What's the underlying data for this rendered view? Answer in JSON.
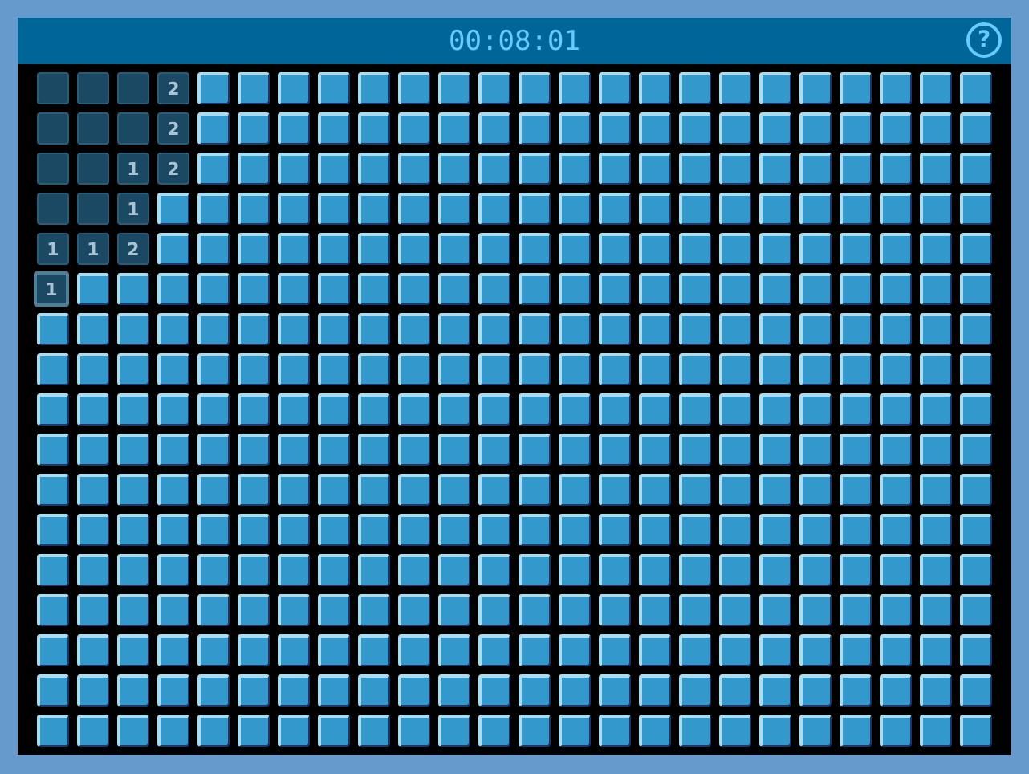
{
  "header": {
    "timer": "00:08:01",
    "help_button": "?"
  },
  "board": {
    "rows": [
      [
        {
          "revealed": true,
          "selected": false
        },
        {
          "revealed": true,
          "selected": false
        },
        {
          "revealed": true,
          "selected": false
        },
        {
          "revealed": true,
          "selected": false,
          "number": "2"
        },
        {
          "revealed": false,
          "selected": false
        },
        {
          "revealed": false,
          "selected": false
        },
        {
          "revealed": false,
          "selected": false
        },
        {
          "revealed": false,
          "selected": false
        },
        {
          "revealed": false,
          "selected": false
        },
        {
          "revealed": false,
          "selected": false
        },
        {
          "revealed": false,
          "selected": false
        },
        {
          "revealed": false,
          "selected": false
        },
        {
          "revealed": false,
          "selected": false
        },
        {
          "revealed": false,
          "selected": false
        },
        {
          "revealed": false,
          "selected": false
        },
        {
          "revealed": false,
          "selected": false
        },
        {
          "revealed": false,
          "selected": false
        },
        {
          "revealed": false,
          "selected": false
        },
        {
          "revealed": false,
          "selected": false
        },
        {
          "revealed": false,
          "selected": false
        },
        {
          "revealed": false,
          "selected": false
        },
        {
          "revealed": false,
          "selected": false
        },
        {
          "revealed": false,
          "selected": false
        },
        {
          "revealed": false,
          "selected": false
        }
      ],
      [
        {
          "revealed": true,
          "selected": false
        },
        {
          "revealed": true,
          "selected": false
        },
        {
          "revealed": true,
          "selected": false
        },
        {
          "revealed": true,
          "selected": false,
          "number": "2"
        },
        {
          "revealed": false,
          "selected": false
        },
        {
          "revealed": false,
          "selected": false
        },
        {
          "revealed": false,
          "selected": false
        },
        {
          "revealed": false,
          "selected": false
        },
        {
          "revealed": false,
          "selected": false
        },
        {
          "revealed": false,
          "selected": false
        },
        {
          "revealed": false,
          "selected": false
        },
        {
          "revealed": false,
          "selected": false
        },
        {
          "revealed": false,
          "selected": false
        },
        {
          "revealed": false,
          "selected": false
        },
        {
          "revealed": false,
          "selected": false
        },
        {
          "revealed": false,
          "selected": false
        },
        {
          "revealed": false,
          "selected": false
        },
        {
          "revealed": false,
          "selected": false
        },
        {
          "revealed": false,
          "selected": false
        },
        {
          "revealed": false,
          "selected": false
        },
        {
          "revealed": false,
          "selected": false
        },
        {
          "revealed": false,
          "selected": false
        },
        {
          "revealed": false,
          "selected": false
        },
        {
          "revealed": false,
          "selected": false
        }
      ],
      [
        {
          "revealed": true,
          "selected": false
        },
        {
          "revealed": true,
          "selected": false
        },
        {
          "revealed": true,
          "selected": false,
          "number": "1"
        },
        {
          "revealed": true,
          "selected": false,
          "number": "2"
        },
        {
          "revealed": false,
          "selected": false
        },
        {
          "revealed": false,
          "selected": false
        },
        {
          "revealed": false,
          "selected": false
        },
        {
          "revealed": false,
          "selected": false
        },
        {
          "revealed": false,
          "selected": false
        },
        {
          "revealed": false,
          "selected": false
        },
        {
          "revealed": false,
          "selected": false
        },
        {
          "revealed": false,
          "selected": false
        },
        {
          "revealed": false,
          "selected": false
        },
        {
          "revealed": false,
          "selected": false
        },
        {
          "revealed": false,
          "selected": false
        },
        {
          "revealed": false,
          "selected": false
        },
        {
          "revealed": false,
          "selected": false
        },
        {
          "revealed": false,
          "selected": false
        },
        {
          "revealed": false,
          "selected": false
        },
        {
          "revealed": false,
          "selected": false
        },
        {
          "revealed": false,
          "selected": false
        },
        {
          "revealed": false,
          "selected": false
        },
        {
          "revealed": false,
          "selected": false
        },
        {
          "revealed": false,
          "selected": false
        }
      ],
      [
        {
          "revealed": true,
          "selected": false
        },
        {
          "revealed": true,
          "selected": false
        },
        {
          "revealed": true,
          "selected": false,
          "number": "1"
        },
        {
          "revealed": false,
          "selected": false
        },
        {
          "revealed": false,
          "selected": false
        },
        {
          "revealed": false,
          "selected": false
        },
        {
          "revealed": false,
          "selected": false
        },
        {
          "revealed": false,
          "selected": false
        },
        {
          "revealed": false,
          "selected": false
        },
        {
          "revealed": false,
          "selected": false
        },
        {
          "revealed": false,
          "selected": false
        },
        {
          "revealed": false,
          "selected": false
        },
        {
          "revealed": false,
          "selected": false
        },
        {
          "revealed": false,
          "selected": false
        },
        {
          "revealed": false,
          "selected": false
        },
        {
          "revealed": false,
          "selected": false
        },
        {
          "revealed": false,
          "selected": false
        },
        {
          "revealed": false,
          "selected": false
        },
        {
          "revealed": false,
          "selected": false
        },
        {
          "revealed": false,
          "selected": false
        },
        {
          "revealed": false,
          "selected": false
        },
        {
          "revealed": false,
          "selected": false
        },
        {
          "revealed": false,
          "selected": false
        },
        {
          "revealed": false,
          "selected": false
        }
      ],
      [
        {
          "revealed": true,
          "selected": false,
          "number": "1"
        },
        {
          "revealed": true,
          "selected": false,
          "number": "1"
        },
        {
          "revealed": true,
          "selected": false,
          "number": "2"
        },
        {
          "revealed": false,
          "selected": false
        },
        {
          "revealed": false,
          "selected": false
        },
        {
          "revealed": false,
          "selected": false
        },
        {
          "revealed": false,
          "selected": false
        },
        {
          "revealed": false,
          "selected": false
        },
        {
          "revealed": false,
          "selected": false
        },
        {
          "revealed": false,
          "selected": false
        },
        {
          "revealed": false,
          "selected": false
        },
        {
          "revealed": false,
          "selected": false
        },
        {
          "revealed": false,
          "selected": false
        },
        {
          "revealed": false,
          "selected": false
        },
        {
          "revealed": false,
          "selected": false
        },
        {
          "revealed": false,
          "selected": false
        },
        {
          "revealed": false,
          "selected": false
        },
        {
          "revealed": false,
          "selected": false
        },
        {
          "revealed": false,
          "selected": false
        },
        {
          "revealed": false,
          "selected": false
        },
        {
          "revealed": false,
          "selected": false
        },
        {
          "revealed": false,
          "selected": false
        },
        {
          "revealed": false,
          "selected": false
        },
        {
          "revealed": false,
          "selected": false
        }
      ],
      [
        {
          "revealed": true,
          "selected": true,
          "number": "1"
        },
        {
          "revealed": false,
          "selected": false
        },
        {
          "revealed": false,
          "selected": false
        },
        {
          "revealed": false,
          "selected": false
        },
        {
          "revealed": false,
          "selected": false
        },
        {
          "revealed": false,
          "selected": false
        },
        {
          "revealed": false,
          "selected": false
        },
        {
          "revealed": false,
          "selected": false
        },
        {
          "revealed": false,
          "selected": false
        },
        {
          "revealed": false,
          "selected": false
        },
        {
          "revealed": false,
          "selected": false
        },
        {
          "revealed": false,
          "selected": false
        },
        {
          "revealed": false,
          "selected": false
        },
        {
          "revealed": false,
          "selected": false
        },
        {
          "revealed": false,
          "selected": false
        },
        {
          "revealed": false,
          "selected": false
        },
        {
          "revealed": false,
          "selected": false
        },
        {
          "revealed": false,
          "selected": false
        },
        {
          "revealed": false,
          "selected": false
        },
        {
          "revealed": false,
          "selected": false
        },
        {
          "revealed": false,
          "selected": false
        },
        {
          "revealed": false,
          "selected": false
        },
        {
          "revealed": false,
          "selected": false
        },
        {
          "revealed": false,
          "selected": false
        }
      ],
      [
        {
          "revealed": false,
          "selected": false
        },
        {
          "revealed": false,
          "selected": false
        },
        {
          "revealed": false,
          "selected": false
        },
        {
          "revealed": false,
          "selected": false
        },
        {
          "revealed": false,
          "selected": false
        },
        {
          "revealed": false,
          "selected": false
        },
        {
          "revealed": false,
          "selected": false
        },
        {
          "revealed": false,
          "selected": false
        },
        {
          "revealed": false,
          "selected": false
        },
        {
          "revealed": false,
          "selected": false
        },
        {
          "revealed": false,
          "selected": false
        },
        {
          "revealed": false,
          "selected": false
        },
        {
          "revealed": false,
          "selected": false
        },
        {
          "revealed": false,
          "selected": false
        },
        {
          "revealed": false,
          "selected": false
        },
        {
          "revealed": false,
          "selected": false
        },
        {
          "revealed": false,
          "selected": false
        },
        {
          "revealed": false,
          "selected": false
        },
        {
          "revealed": false,
          "selected": false
        },
        {
          "revealed": false,
          "selected": false
        },
        {
          "revealed": false,
          "selected": false
        },
        {
          "revealed": false,
          "selected": false
        },
        {
          "revealed": false,
          "selected": false
        },
        {
          "revealed": false,
          "selected": false
        }
      ],
      [
        {
          "revealed": false,
          "selected": false
        },
        {
          "revealed": false,
          "selected": false
        },
        {
          "revealed": false,
          "selected": false
        },
        {
          "revealed": false,
          "selected": false
        },
        {
          "revealed": false,
          "selected": false
        },
        {
          "revealed": false,
          "selected": false
        },
        {
          "revealed": false,
          "selected": false
        },
        {
          "revealed": false,
          "selected": false
        },
        {
          "revealed": false,
          "selected": false
        },
        {
          "revealed": false,
          "selected": false
        },
        {
          "revealed": false,
          "selected": false
        },
        {
          "revealed": false,
          "selected": false
        },
        {
          "revealed": false,
          "selected": false
        },
        {
          "revealed": false,
          "selected": false
        },
        {
          "revealed": false,
          "selected": false
        },
        {
          "revealed": false,
          "selected": false
        },
        {
          "revealed": false,
          "selected": false
        },
        {
          "revealed": false,
          "selected": false
        },
        {
          "revealed": false,
          "selected": false
        },
        {
          "revealed": false,
          "selected": false
        },
        {
          "revealed": false,
          "selected": false
        },
        {
          "revealed": false,
          "selected": false
        },
        {
          "revealed": false,
          "selected": false
        },
        {
          "revealed": false,
          "selected": false
        }
      ],
      [
        {
          "revealed": false,
          "selected": false
        },
        {
          "revealed": false,
          "selected": false
        },
        {
          "revealed": false,
          "selected": false
        },
        {
          "revealed": false,
          "selected": false
        },
        {
          "revealed": false,
          "selected": false
        },
        {
          "revealed": false,
          "selected": false
        },
        {
          "revealed": false,
          "selected": false
        },
        {
          "revealed": false,
          "selected": false
        },
        {
          "revealed": false,
          "selected": false
        },
        {
          "revealed": false,
          "selected": false
        },
        {
          "revealed": false,
          "selected": false
        },
        {
          "revealed": false,
          "selected": false
        },
        {
          "revealed": false,
          "selected": false
        },
        {
          "revealed": false,
          "selected": false
        },
        {
          "revealed": false,
          "selected": false
        },
        {
          "revealed": false,
          "selected": false
        },
        {
          "revealed": false,
          "selected": false
        },
        {
          "revealed": false,
          "selected": false
        },
        {
          "revealed": false,
          "selected": false
        },
        {
          "revealed": false,
          "selected": false
        },
        {
          "revealed": false,
          "selected": false
        },
        {
          "revealed": false,
          "selected": false
        },
        {
          "revealed": false,
          "selected": false
        },
        {
          "revealed": false,
          "selected": false
        }
      ],
      [
        {
          "revealed": false,
          "selected": false
        },
        {
          "revealed": false,
          "selected": false
        },
        {
          "revealed": false,
          "selected": false
        },
        {
          "revealed": false,
          "selected": false
        },
        {
          "revealed": false,
          "selected": false
        },
        {
          "revealed": false,
          "selected": false
        },
        {
          "revealed": false,
          "selected": false
        },
        {
          "revealed": false,
          "selected": false
        },
        {
          "revealed": false,
          "selected": false
        },
        {
          "revealed": false,
          "selected": false
        },
        {
          "revealed": false,
          "selected": false
        },
        {
          "revealed": false,
          "selected": false
        },
        {
          "revealed": false,
          "selected": false
        },
        {
          "revealed": false,
          "selected": false
        },
        {
          "revealed": false,
          "selected": false
        },
        {
          "revealed": false,
          "selected": false
        },
        {
          "revealed": false,
          "selected": false
        },
        {
          "revealed": false,
          "selected": false
        },
        {
          "revealed": false,
          "selected": false
        },
        {
          "revealed": false,
          "selected": false
        },
        {
          "revealed": false,
          "selected": false
        },
        {
          "revealed": false,
          "selected": false
        },
        {
          "revealed": false,
          "selected": false
        },
        {
          "revealed": false,
          "selected": false
        }
      ],
      [
        {
          "revealed": false,
          "selected": false
        },
        {
          "revealed": false,
          "selected": false
        },
        {
          "revealed": false,
          "selected": false
        },
        {
          "revealed": false,
          "selected": false
        },
        {
          "revealed": false,
          "selected": false
        },
        {
          "revealed": false,
          "selected": false
        },
        {
          "revealed": false,
          "selected": false
        },
        {
          "revealed": false,
          "selected": false
        },
        {
          "revealed": false,
          "selected": false
        },
        {
          "revealed": false,
          "selected": false
        },
        {
          "revealed": false,
          "selected": false
        },
        {
          "revealed": false,
          "selected": false
        },
        {
          "revealed": false,
          "selected": false
        },
        {
          "revealed": false,
          "selected": false
        },
        {
          "revealed": false,
          "selected": false
        },
        {
          "revealed": false,
          "selected": false
        },
        {
          "revealed": false,
          "selected": false
        },
        {
          "revealed": false,
          "selected": false
        },
        {
          "revealed": false,
          "selected": false
        },
        {
          "revealed": false,
          "selected": false
        },
        {
          "revealed": false,
          "selected": false
        },
        {
          "revealed": false,
          "selected": false
        },
        {
          "revealed": false,
          "selected": false
        },
        {
          "revealed": false,
          "selected": false
        }
      ],
      [
        {
          "revealed": false,
          "selected": false
        },
        {
          "revealed": false,
          "selected": false
        },
        {
          "revealed": false,
          "selected": false
        },
        {
          "revealed": false,
          "selected": false
        },
        {
          "revealed": false,
          "selected": false
        },
        {
          "revealed": false,
          "selected": false
        },
        {
          "revealed": false,
          "selected": false
        },
        {
          "revealed": false,
          "selected": false
        },
        {
          "revealed": false,
          "selected": false
        },
        {
          "revealed": false,
          "selected": false
        },
        {
          "revealed": false,
          "selected": false
        },
        {
          "revealed": false,
          "selected": false
        },
        {
          "revealed": false,
          "selected": false
        },
        {
          "revealed": false,
          "selected": false
        },
        {
          "revealed": false,
          "selected": false
        },
        {
          "revealed": false,
          "selected": false
        },
        {
          "revealed": false,
          "selected": false
        },
        {
          "revealed": false,
          "selected": false
        },
        {
          "revealed": false,
          "selected": false
        },
        {
          "revealed": false,
          "selected": false
        },
        {
          "revealed": false,
          "selected": false
        },
        {
          "revealed": false,
          "selected": false
        },
        {
          "revealed": false,
          "selected": false
        },
        {
          "revealed": false,
          "selected": false
        }
      ],
      [
        {
          "revealed": false,
          "selected": false
        },
        {
          "revealed": false,
          "selected": false
        },
        {
          "revealed": false,
          "selected": false
        },
        {
          "revealed": false,
          "selected": false
        },
        {
          "revealed": false,
          "selected": false
        },
        {
          "revealed": false,
          "selected": false
        },
        {
          "revealed": false,
          "selected": false
        },
        {
          "revealed": false,
          "selected": false
        },
        {
          "revealed": false,
          "selected": false
        },
        {
          "revealed": false,
          "selected": false
        },
        {
          "revealed": false,
          "selected": false
        },
        {
          "revealed": false,
          "selected": false
        },
        {
          "revealed": false,
          "selected": false
        },
        {
          "revealed": false,
          "selected": false
        },
        {
          "revealed": false,
          "selected": false
        },
        {
          "revealed": false,
          "selected": false
        },
        {
          "revealed": false,
          "selected": false
        },
        {
          "revealed": false,
          "selected": false
        },
        {
          "revealed": false,
          "selected": false
        },
        {
          "revealed": false,
          "selected": false
        },
        {
          "revealed": false,
          "selected": false
        },
        {
          "revealed": false,
          "selected": false
        },
        {
          "revealed": false,
          "selected": false
        },
        {
          "revealed": false,
          "selected": false
        }
      ],
      [
        {
          "revealed": false,
          "selected": false
        },
        {
          "revealed": false,
          "selected": false
        },
        {
          "revealed": false,
          "selected": false
        },
        {
          "revealed": false,
          "selected": false
        },
        {
          "revealed": false,
          "selected": false
        },
        {
          "revealed": false,
          "selected": false
        },
        {
          "revealed": false,
          "selected": false
        },
        {
          "revealed": false,
          "selected": false
        },
        {
          "revealed": false,
          "selected": false
        },
        {
          "revealed": false,
          "selected": false
        },
        {
          "revealed": false,
          "selected": false
        },
        {
          "revealed": false,
          "selected": false
        },
        {
          "revealed": false,
          "selected": false
        },
        {
          "revealed": false,
          "selected": false
        },
        {
          "revealed": false,
          "selected": false
        },
        {
          "revealed": false,
          "selected": false
        },
        {
          "revealed": false,
          "selected": false
        },
        {
          "revealed": false,
          "selected": false
        },
        {
          "revealed": false,
          "selected": false
        },
        {
          "revealed": false,
          "selected": false
        },
        {
          "revealed": false,
          "selected": false
        },
        {
          "revealed": false,
          "selected": false
        },
        {
          "revealed": false,
          "selected": false
        },
        {
          "revealed": false,
          "selected": false
        }
      ],
      [
        {
          "revealed": false,
          "selected": false
        },
        {
          "revealed": false,
          "selected": false
        },
        {
          "revealed": false,
          "selected": false
        },
        {
          "revealed": false,
          "selected": false
        },
        {
          "revealed": false,
          "selected": false
        },
        {
          "revealed": false,
          "selected": false
        },
        {
          "revealed": false,
          "selected": false
        },
        {
          "revealed": false,
          "selected": false
        },
        {
          "revealed": false,
          "selected": false
        },
        {
          "revealed": false,
          "selected": false
        },
        {
          "revealed": false,
          "selected": false
        },
        {
          "revealed": false,
          "selected": false
        },
        {
          "revealed": false,
          "selected": false
        },
        {
          "revealed": false,
          "selected": false
        },
        {
          "revealed": false,
          "selected": false
        },
        {
          "revealed": false,
          "selected": false
        },
        {
          "revealed": false,
          "selected": false
        },
        {
          "revealed": false,
          "selected": false
        },
        {
          "revealed": false,
          "selected": false
        },
        {
          "revealed": false,
          "selected": false
        },
        {
          "revealed": false,
          "selected": false
        },
        {
          "revealed": false,
          "selected": false
        },
        {
          "revealed": false,
          "selected": false
        },
        {
          "revealed": false,
          "selected": false
        }
      ],
      [
        {
          "revealed": false,
          "selected": false
        },
        {
          "revealed": false,
          "selected": false
        },
        {
          "revealed": false,
          "selected": false
        },
        {
          "revealed": false,
          "selected": false
        },
        {
          "revealed": false,
          "selected": false
        },
        {
          "revealed": false,
          "selected": false
        },
        {
          "revealed": false,
          "selected": false
        },
        {
          "revealed": false,
          "selected": false
        },
        {
          "revealed": false,
          "selected": false
        },
        {
          "revealed": false,
          "selected": false
        },
        {
          "revealed": false,
          "selected": false
        },
        {
          "revealed": false,
          "selected": false
        },
        {
          "revealed": false,
          "selected": false
        },
        {
          "revealed": false,
          "selected": false
        },
        {
          "revealed": false,
          "selected": false
        },
        {
          "revealed": false,
          "selected": false
        },
        {
          "revealed": false,
          "selected": false
        },
        {
          "revealed": false,
          "selected": false
        },
        {
          "revealed": false,
          "selected": false
        },
        {
          "revealed": false,
          "selected": false
        },
        {
          "revealed": false,
          "selected": false
        },
        {
          "revealed": false,
          "selected": false
        },
        {
          "revealed": false,
          "selected": false
        },
        {
          "revealed": false,
          "selected": false
        }
      ],
      [
        {
          "revealed": false,
          "selected": false
        },
        {
          "revealed": false,
          "selected": false
        },
        {
          "revealed": false,
          "selected": false
        },
        {
          "revealed": false,
          "selected": false
        },
        {
          "revealed": false,
          "selected": false
        },
        {
          "revealed": false,
          "selected": false
        },
        {
          "revealed": false,
          "selected": false
        },
        {
          "revealed": false,
          "selected": false
        },
        {
          "revealed": false,
          "selected": false
        },
        {
          "revealed": false,
          "selected": false
        },
        {
          "revealed": false,
          "selected": false
        },
        {
          "revealed": false,
          "selected": false
        },
        {
          "revealed": false,
          "selected": false
        },
        {
          "revealed": false,
          "selected": false
        },
        {
          "revealed": false,
          "selected": false
        },
        {
          "revealed": false,
          "selected": false
        },
        {
          "revealed": false,
          "selected": false
        },
        {
          "revealed": false,
          "selected": false
        },
        {
          "revealed": false,
          "selected": false
        },
        {
          "revealed": false,
          "selected": false
        },
        {
          "revealed": false,
          "selected": false
        },
        {
          "revealed": false,
          "selected": false
        },
        {
          "revealed": false,
          "selected": false
        },
        {
          "revealed": false,
          "selected": false
        }
      ]
    ]
  }
}
